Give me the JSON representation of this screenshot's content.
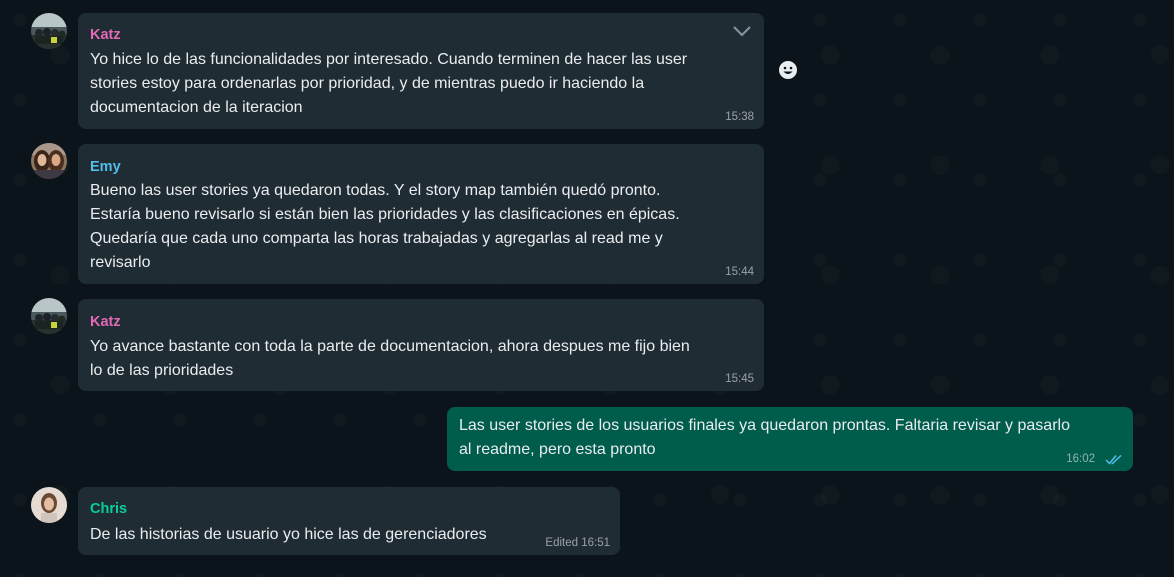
{
  "colors": {
    "background": "#0b141a",
    "incoming_bubble": "#202c33",
    "outgoing_bubble": "#005c4b",
    "text": "#e9edef",
    "read_ticks": "#53bdeb",
    "katz_name": "#e26ab6",
    "emy_name": "#53bdeb",
    "chris_name": "#06cf9c"
  },
  "messages": [
    {
      "sender": "Katz",
      "text": "Yo hice lo de las funcionalidades por interesado. Cuando terminen de hacer las user\nstories estoy para ordenarlas por prioridad, y de mientras puedo ir haciendo la\ndocumentacion de la iteracion",
      "time": "15:38",
      "icons": [
        "avatar",
        "chevron-down-icon",
        "emoji-react-icon"
      ]
    },
    {
      "sender": "Emy",
      "text": "Bueno las user stories ya quedaron todas. Y el story map también quedó pronto.\nEstaría bueno revisarlo si están bien las prioridades y las clasificaciones en épicas.\nQuedaría que cada uno comparta las horas trabajadas y agregarlas al read me y\nrevisarlo",
      "time": "15:44"
    },
    {
      "sender": "Katz",
      "text": "Yo avance bastante con toda la parte de documentacion, ahora despues me fijo bien\nlo de las prioridades",
      "time": "15:45"
    },
    {
      "sender": "",
      "outgoing": true,
      "text": "Las user stories de los usuarios finales ya quedaron prontas. Faltaria revisar y pasarlo\nal readme, pero esta pronto",
      "time": "16:02",
      "status_icon": "double-check-read-icon"
    },
    {
      "sender": "Chris",
      "text": "De las historias de usuario yo hice las de gerenciadores",
      "time": "Edited 16:51"
    }
  ]
}
